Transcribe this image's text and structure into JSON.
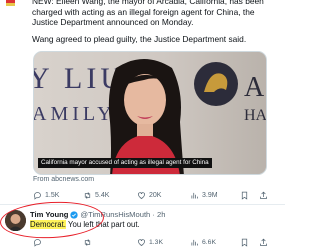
{
  "post": {
    "text_p1": "NEW: Eileen Wang, the mayor of Arcadia, California, has been charged with acting as an illegal foreign agent for China, the Justice Department announced on Monday.",
    "text_p2": "Wang agreed to plead guilty, the Justice Department said.",
    "media": {
      "background_text_left": "Y LIU",
      "background_text_left2": "AMILY",
      "background_text_right": "A",
      "background_text_right2": "HA",
      "caption": "California mayor accused of acting as illegal agent for China"
    },
    "source": "From abcnews.com",
    "actions": {
      "replies": "1.5K",
      "reposts": "5.4K",
      "likes": "20K",
      "views": "3.9M"
    }
  },
  "reply": {
    "author_name": "Tim Young",
    "handle_time": "@TimRunsHisMouth · 2h",
    "highlighted": "Democrat.",
    "text_rest": " You left that part out.",
    "actions": {
      "replies": "",
      "reposts": "",
      "likes": "1.3K",
      "views": "6.6K"
    }
  },
  "colors": {
    "annotation_circle": "#e8202a",
    "highlight": "#fff35a",
    "verified": "#1d9bf0"
  },
  "icons": [
    "reply-icon",
    "repost-icon",
    "like-icon",
    "views-icon",
    "bookmark-icon",
    "share-icon",
    "verified-icon"
  ]
}
